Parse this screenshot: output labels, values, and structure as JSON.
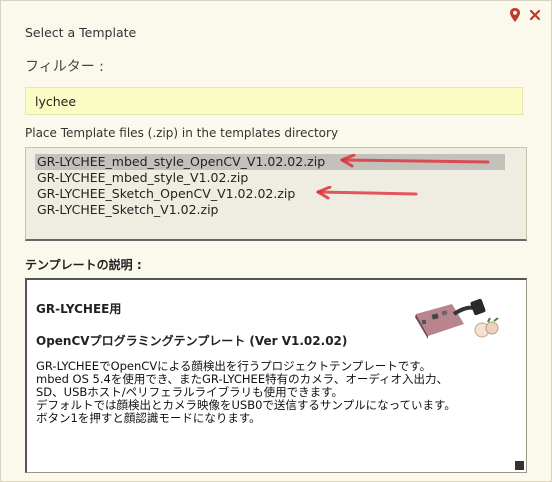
{
  "dialog": {
    "title": "Select a Template",
    "filter_label": "フィルター :",
    "filter_value": "lychee",
    "directory_label": "Place Template files (.zip) in the templates directory",
    "files": [
      "GR-LYCHEE_mbed_style_OpenCV_V1.02.02.zip",
      "GR-LYCHEE_mbed_style_V1.02.zip",
      "GR-LYCHEE_Sketch_OpenCV_V1.02.02.zip",
      "GR-LYCHEE_Sketch_V1.02.zip"
    ],
    "selected_index": 0,
    "description_label": "テンプレートの説明 :",
    "description": {
      "heading": "GR-LYCHEE用",
      "subheading": "OpenCVプログラミングテンプレート (Ver V1.02.02)",
      "lines": [
        "GR-LYCHEEでOpenCVによる顔検出を行うプロジェクトテンプレートです。",
        "mbed OS 5.4を使用でき、またGR-LYCHEE特有のカメラ、オーディオ入出力、",
        "SD、USBホスト/ペリフェラルライブラリも使用できます。",
        "デフォルトでは顔検出とカメラ映像をUSB0で送信するサンプルになっています。",
        "ボタン1を押すと顔認識モードになります。"
      ]
    }
  },
  "icons": {
    "pin": "pin-icon",
    "close": "close-icon",
    "arrow": "red-arrow-annotation",
    "board": "board-image"
  },
  "colors": {
    "background": "#fbf8ec",
    "filter_bg": "#fafcc4",
    "selection": "#c3c1bc",
    "pin": "#c0392b",
    "arrow": "#e0303a"
  }
}
